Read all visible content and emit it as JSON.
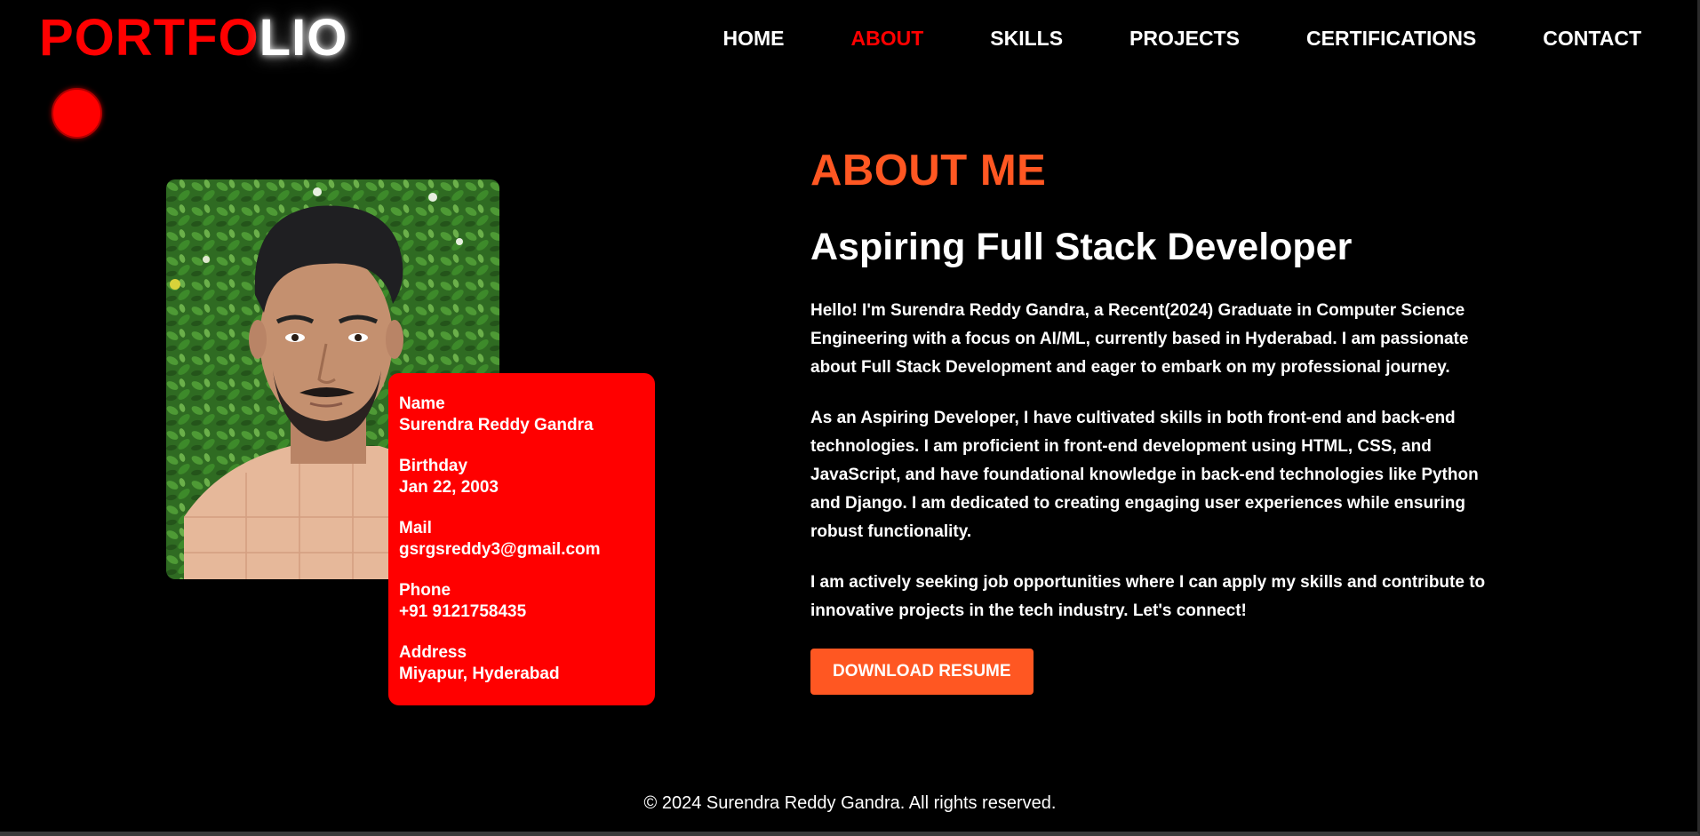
{
  "header": {
    "logo_part1": "PORTFO",
    "logo_part2": "LIO",
    "nav": [
      {
        "label": "HOME"
      },
      {
        "label": "ABOUT"
      },
      {
        "label": "SKILLS"
      },
      {
        "label": "PROJECTS"
      },
      {
        "label": "CERTIFICATIONS"
      },
      {
        "label": "CONTACT"
      }
    ],
    "active_nav": "ABOUT"
  },
  "info_card": {
    "items": [
      {
        "label": "Name",
        "value": "Surendra Reddy Gandra"
      },
      {
        "label": "Birthday",
        "value": "Jan 22, 2003"
      },
      {
        "label": "Mail",
        "value": "gsrgsreddy3@gmail.com"
      },
      {
        "label": "Phone",
        "value": "+91 9121758435"
      },
      {
        "label": "Address",
        "value": "Miyapur, Hyderabad"
      }
    ]
  },
  "about": {
    "heading": "ABOUT ME",
    "subheading": "Aspiring Full Stack Developer",
    "paragraphs": [
      "Hello! I'm Surendra Reddy Gandra, a Recent(2024) Graduate in Computer Science Engineering with a focus on AI/ML, currently based in Hyderabad. I am passionate about Full Stack Development and eager to embark on my professional journey.",
      "As an Aspiring Developer, I have cultivated skills in both front-end and back-end technologies. I am proficient in front-end development using HTML, CSS, and JavaScript, and have foundational knowledge in back-end technologies like Python and Django. I am dedicated to creating engaging user experiences while ensuring robust functionality.",
      "I am actively seeking job opportunities where I can apply my skills and contribute to innovative projects in the tech industry. Let's connect!"
    ],
    "download_button": "DOWNLOAD RESUME"
  },
  "footer": {
    "text": "© 2024 Surendra Reddy Gandra. All rights reserved."
  },
  "colors": {
    "background": "#000000",
    "accent_red": "#ff0000",
    "accent_orange": "#ff5722",
    "text": "#ffffff"
  },
  "icons": {
    "decor_dot": "red-dot",
    "profile_photo": "profile-photo"
  }
}
